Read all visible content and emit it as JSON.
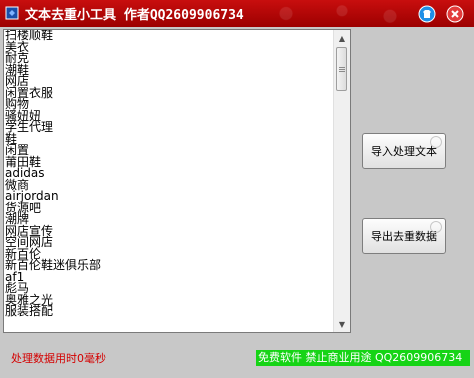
{
  "window": {
    "title": "文本去重小工具 作者QQ2609906734"
  },
  "textarea": {
    "lines": [
      "扫楼顺鞋",
      "美衣",
      "耐克",
      "潮鞋",
      "网店",
      "闲置衣服",
      "购物",
      "骚妞妞",
      "学生代理",
      "鞋",
      "闲置",
      "莆田鞋",
      "adidas",
      "微商",
      "airjordan",
      "货源吧",
      "潮牌",
      "网店宣传",
      "空间网店",
      "新百伦",
      "新百伦鞋迷俱乐部",
      "af1",
      "彪马",
      "奥雅之光",
      "服装搭配"
    ]
  },
  "buttons": {
    "import_label": "导入处理文本",
    "export_label": "导出去重数据"
  },
  "status": {
    "elapsed_text": "处理数据用时0毫秒",
    "notice_text": "免费软件 禁止商业用途 QQ2609906734"
  },
  "colors": {
    "titlebar": "#b30000",
    "status_text": "#d40000",
    "notice_bg": "#16d416"
  }
}
